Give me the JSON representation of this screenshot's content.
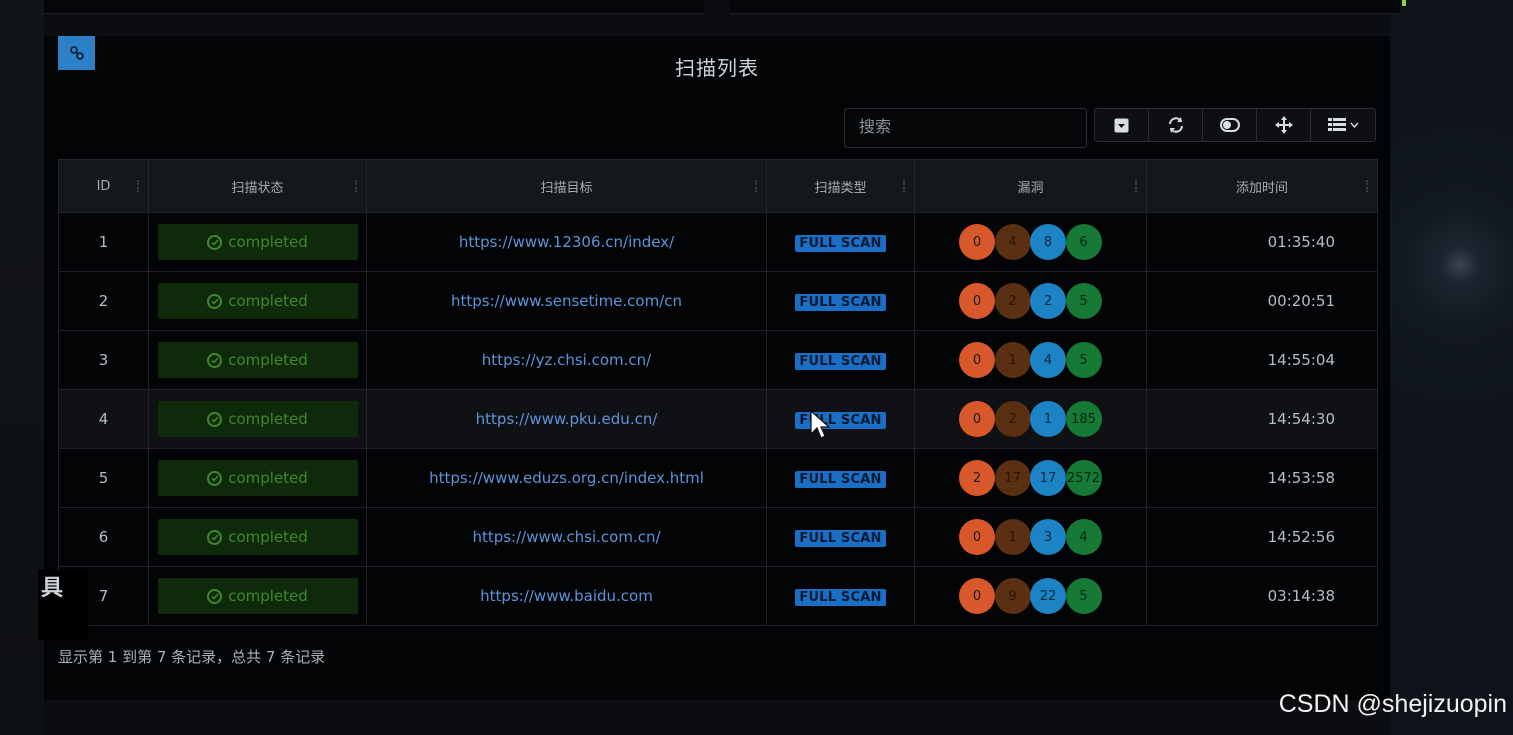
{
  "panel": {
    "title": "扫描列表",
    "search_placeholder": "搜索"
  },
  "toolbar": {
    "buttons": [
      {
        "name": "toggle-button",
        "icon": "caret-box-icon"
      },
      {
        "name": "refresh-button",
        "icon": "refresh-icon"
      },
      {
        "name": "toggle-view-button",
        "icon": "toggle-icon"
      },
      {
        "name": "fullscreen-button",
        "icon": "move-icon"
      },
      {
        "name": "columns-button",
        "icon": "list-icon"
      }
    ]
  },
  "table": {
    "headers": [
      "ID",
      "扫描状态",
      "扫描目标",
      "扫描类型",
      "漏洞",
      "添加时间"
    ],
    "rows": [
      {
        "id": "1",
        "status": "completed",
        "target": "https://www.12306.cn/index/",
        "type": "FULL SCAN",
        "vulns": [
          "0",
          "4",
          "8",
          "6"
        ],
        "time": "01:35:40"
      },
      {
        "id": "2",
        "status": "completed",
        "target": "https://www.sensetime.com/cn",
        "type": "FULL SCAN",
        "vulns": [
          "0",
          "2",
          "2",
          "5"
        ],
        "time": "00:20:51"
      },
      {
        "id": "3",
        "status": "completed",
        "target": "https://yz.chsi.com.cn/",
        "type": "FULL SCAN",
        "vulns": [
          "0",
          "1",
          "4",
          "5"
        ],
        "time": "14:55:04"
      },
      {
        "id": "4",
        "status": "completed",
        "target": "https://www.pku.edu.cn/",
        "type": "FULL SCAN",
        "vulns": [
          "0",
          "2",
          "1",
          "185"
        ],
        "time": "14:54:30"
      },
      {
        "id": "5",
        "status": "completed",
        "target": "https://www.eduzs.org.cn/index.html",
        "type": "FULL SCAN",
        "vulns": [
          "2",
          "17",
          "17",
          "2572"
        ],
        "time": "14:53:58"
      },
      {
        "id": "6",
        "status": "completed",
        "target": "https://www.chsi.com.cn/",
        "type": "FULL SCAN",
        "vulns": [
          "0",
          "1",
          "3",
          "4"
        ],
        "time": "14:52:56"
      },
      {
        "id": "7",
        "status": "completed",
        "target": "https://www.baidu.com",
        "type": "FULL SCAN",
        "vulns": [
          "0",
          "9",
          "22",
          "5"
        ],
        "time": "03:14:38"
      }
    ]
  },
  "footer": {
    "summary": "显示第 1 到第 7 条记录，总共 7 条记录"
  },
  "side": {
    "char": "具"
  },
  "watermark": "CSDN @shejizuopin",
  "colors": {
    "accent_blue": "#2d7fc6",
    "status_green": "#3e8a2a",
    "critical": "#d9582b",
    "high": "#5a2f12",
    "medium": "#1c84c4",
    "low": "#167a36"
  }
}
